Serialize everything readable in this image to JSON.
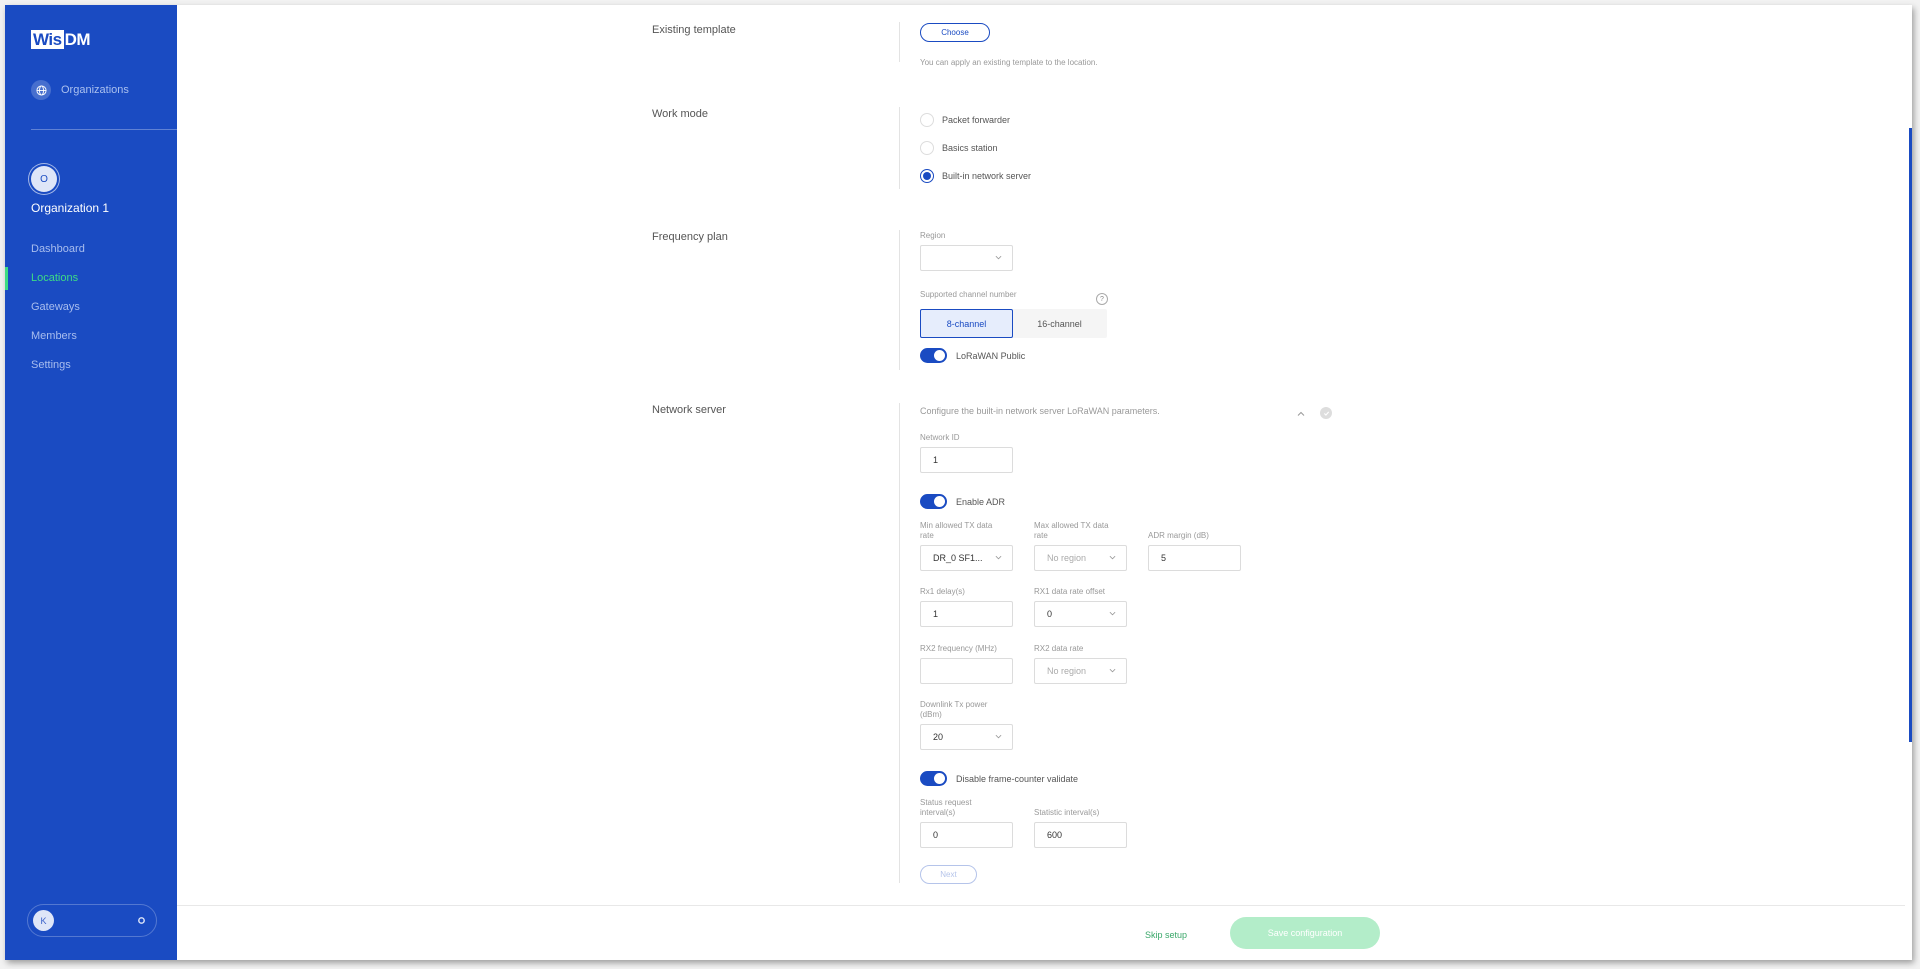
{
  "app": {
    "logo_left": "Wis",
    "logo_right": "DM"
  },
  "sidebar": {
    "organizations_label": "Organizations",
    "org_avatar_letter": "O",
    "org_name": "Organization 1",
    "items": [
      {
        "label": "Dashboard",
        "active": false
      },
      {
        "label": "Locations",
        "active": true
      },
      {
        "label": "Gateways",
        "active": false
      },
      {
        "label": "Members",
        "active": false
      },
      {
        "label": "Settings",
        "active": false
      }
    ],
    "user_avatar_letter": "K"
  },
  "sections": {
    "existing_template": {
      "title": "Existing template",
      "choose_label": "Choose",
      "hint": "You can apply an existing template to the location."
    },
    "work_mode": {
      "title": "Work mode",
      "options": [
        {
          "label": "Packet forwarder",
          "checked": false
        },
        {
          "label": "Basics station",
          "checked": false
        },
        {
          "label": "Built-in network server",
          "checked": true
        }
      ]
    },
    "frequency_plan": {
      "title": "Frequency plan",
      "region_label": "Region",
      "region_value": "",
      "channel_label": "Supported channel number",
      "help_glyph": "?",
      "channels": [
        {
          "label": "8-channel",
          "active": true
        },
        {
          "label": "16-channel",
          "active": false
        }
      ],
      "lorawan_public_label": "LoRaWAN Public",
      "lorawan_public_on": true
    },
    "network_server": {
      "title": "Network server",
      "description": "Configure the built-in network server LoRaWAN parameters.",
      "network_id_label": "Network ID",
      "network_id_value": "1",
      "enable_adr_label": "Enable ADR",
      "enable_adr_on": true,
      "min_tx_label": "Min allowed TX data rate",
      "min_tx_value": "DR_0 SF1...",
      "max_tx_label": "Max allowed TX data rate",
      "max_tx_placeholder": "No region",
      "adr_margin_label": "ADR margin (dB)",
      "adr_margin_value": "5",
      "rx1_delay_label": "Rx1 delay(s)",
      "rx1_delay_value": "1",
      "rx1_offset_label": "RX1 data rate offset",
      "rx1_offset_value": "0",
      "rx2_freq_label": "RX2 frequency (MHz)",
      "rx2_freq_value": "",
      "rx2_rate_label": "RX2 data rate",
      "rx2_rate_placeholder": "No region",
      "downlink_label": "Downlink Tx power (dBm)",
      "downlink_value": "20",
      "frame_counter_label": "Disable frame-counter validate",
      "frame_counter_on": true,
      "status_interval_label": "Status request interval(s)",
      "status_interval_value": "0",
      "statistic_interval_label": "Statistic interval(s)",
      "statistic_interval_value": "600",
      "next_label": "Next"
    }
  },
  "footer": {
    "skip_label": "Skip setup",
    "save_label": "Save configuration"
  },
  "colors": {
    "brand": "#1a4bc2",
    "active_nav": "#3ddc84",
    "save_disabled": "#b3edc9"
  }
}
